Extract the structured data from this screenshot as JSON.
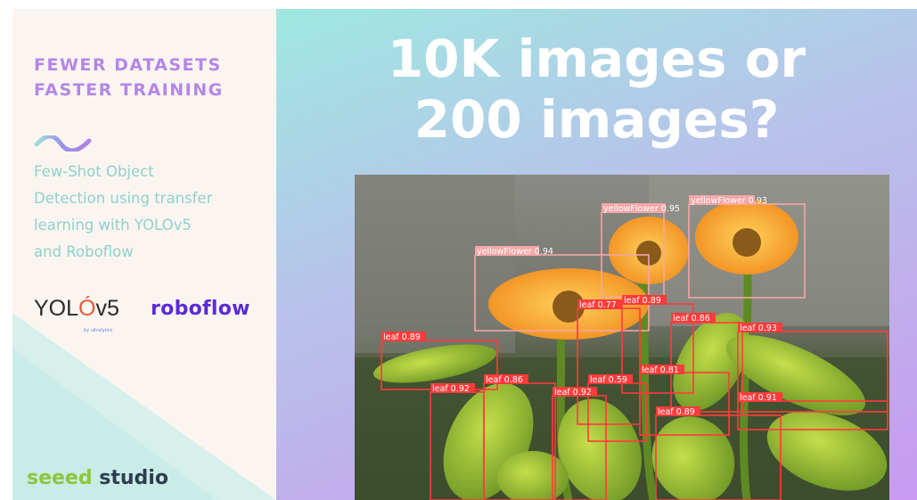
{
  "left_panel": {
    "heading_line1": "FEWER DATASETS",
    "heading_line2": "FASTER TRAINING",
    "subtitle_lines": [
      "Few-Shot Object",
      "Detection using transfer",
      "learning with YOLOv5",
      "and Roboflow"
    ],
    "yolo_logo": {
      "part1": "YOL",
      "part2": "Ó",
      "part3": "v5",
      "by": "by ultralytics"
    },
    "roboflow_logo": "roboflow",
    "seeed_logo": {
      "part1": "seeed",
      "part2": " studio"
    }
  },
  "right_panel": {
    "title_line1": "10K images or",
    "title_line2": "200 images?"
  },
  "detections": [
    {
      "label": "yellowFlower 0.95"
    },
    {
      "label": "yellowFlower 0.93"
    },
    {
      "label": "yellowFlower 0.94"
    },
    {
      "label": "leaf 0.89"
    },
    {
      "label": "leaf 0.77"
    },
    {
      "label": "leaf 0.86"
    },
    {
      "label": "leaf 0.93"
    },
    {
      "label": "leaf 0.89"
    },
    {
      "label": "leaf 0.81"
    },
    {
      "label": "leaf 0.92"
    },
    {
      "label": "leaf 0.86"
    },
    {
      "label": "leaf 0.59"
    },
    {
      "label": "leaf 0.92"
    },
    {
      "label": "leaf 0.91"
    },
    {
      "label": "leaf 0.89"
    }
  ],
  "colors": {
    "heading": "#b487e6",
    "subtitle": "#8fd1c8",
    "flower_box": "#f4a6a6",
    "leaf_box": "#ff3b3b",
    "roboflow": "#5b2ad8",
    "seeed_green": "#8cc63f"
  }
}
